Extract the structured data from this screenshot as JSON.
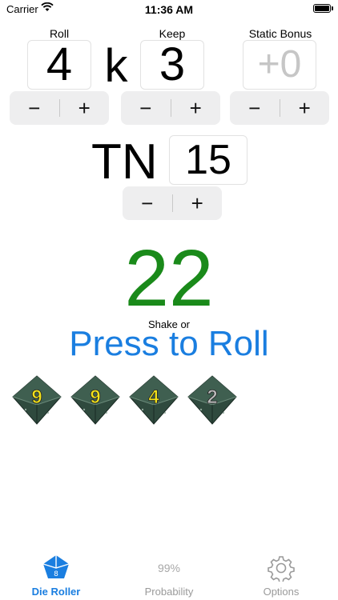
{
  "status": {
    "carrier": "Carrier",
    "time": "11:36 AM"
  },
  "roll": {
    "label": "Roll",
    "value": "4"
  },
  "separator": "k",
  "keep": {
    "label": "Keep",
    "value": "3"
  },
  "bonus": {
    "label": "Static Bonus",
    "value": "+0"
  },
  "tn": {
    "label": "TN",
    "value": "15"
  },
  "stepper": {
    "minus": "−",
    "plus": "+"
  },
  "result": "22",
  "shake_label": "Shake or",
  "roll_button": "Press to Roll",
  "dice": [
    {
      "value": "9",
      "color": "#f2e21a"
    },
    {
      "value": "9",
      "color": "#f2e21a"
    },
    {
      "value": "4",
      "color": "#f2e21a"
    },
    {
      "value": "2",
      "color": "#bdbdbd"
    }
  ],
  "tabs": [
    {
      "label": "Die Roller",
      "active": true
    },
    {
      "label": "Probability",
      "badge": "99%"
    },
    {
      "label": "Options"
    }
  ],
  "colors": {
    "accent": "#1a7ee0",
    "result": "#1a8a1a",
    "die_body": "#2f4a3e"
  }
}
